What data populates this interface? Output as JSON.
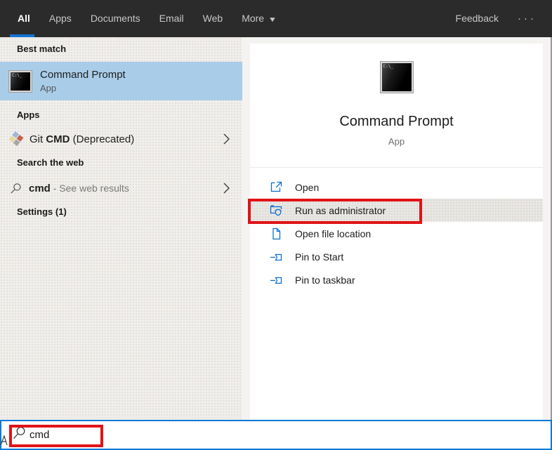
{
  "topbar": {
    "tabs": [
      {
        "label": "All",
        "active": true
      },
      {
        "label": "Apps",
        "active": false
      },
      {
        "label": "Documents",
        "active": false
      },
      {
        "label": "Email",
        "active": false
      },
      {
        "label": "Web",
        "active": false
      },
      {
        "label": "More",
        "active": false,
        "has_dropdown": true
      }
    ],
    "feedback_label": "Feedback"
  },
  "icons": {
    "dropdown_arrow": "▼",
    "more_options": "···",
    "cmd_icon_glyph": "C:\\_"
  },
  "left_panel": {
    "best_match": {
      "header": "Best match",
      "item": {
        "title": "Command Prompt",
        "subtitle": "App",
        "icon": "command-prompt-icon",
        "selected": true
      }
    },
    "apps": {
      "header": "Apps",
      "item": {
        "prefix": "Git ",
        "highlight": "CMD",
        "suffix": " (Deprecated)",
        "icon": "git-icon"
      }
    },
    "search_the_web": {
      "header": "Search the web",
      "item": {
        "query": "cmd",
        "suffix": " - See web results",
        "icon": "search-icon"
      }
    },
    "settings": {
      "header": "Settings (1)"
    }
  },
  "preview_panel": {
    "app_title": "Command Prompt",
    "app_subtitle": "App",
    "icon": "command-prompt-icon",
    "actions": [
      {
        "label": "Open",
        "icon": "open-icon",
        "highlighted": false
      },
      {
        "label": "Run as administrator",
        "icon": "run-as-admin-shield-icon",
        "highlighted": true
      },
      {
        "label": "Open file location",
        "icon": "file-location-icon",
        "highlighted": false
      },
      {
        "label": "Pin to Start",
        "icon": "pin-icon",
        "highlighted": false
      },
      {
        "label": "Pin to taskbar",
        "icon": "pin-icon",
        "highlighted": false
      }
    ]
  },
  "search_bar": {
    "value": "cmd",
    "icon": "search-icon"
  },
  "annotations": {
    "run_as_admin_box": {
      "color": "#e01317"
    },
    "search_box": {
      "color": "#e01317"
    }
  },
  "colors": {
    "topbar_bg": "#2b2b2b",
    "accent_blue": "#0078d7",
    "selected_row_blue": "#a9cde9",
    "action_icon_blue": "#0c6dce",
    "annotation_red": "#e01317",
    "panel_gray": "#f1efec"
  }
}
